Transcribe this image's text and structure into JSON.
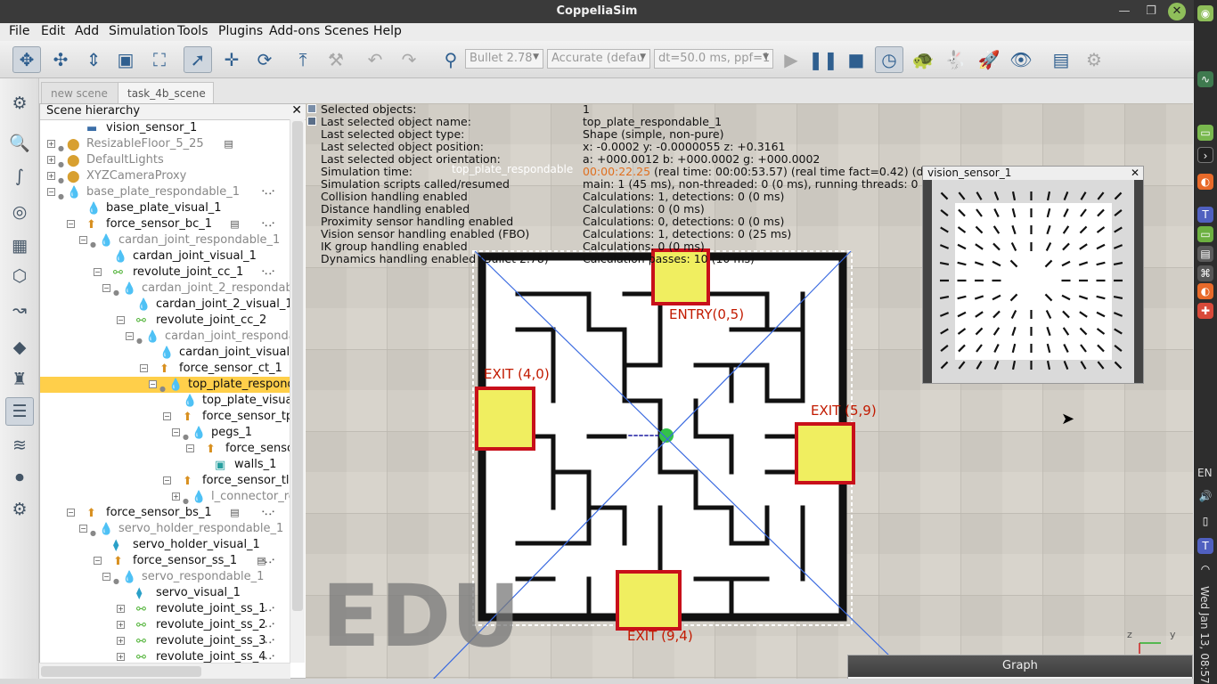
{
  "app": {
    "title": "CoppeliaSim"
  },
  "menu": [
    "File",
    "Edit",
    "Add",
    "Simulation",
    "Tools",
    "Plugins",
    "Add-ons",
    "Scenes",
    "Help"
  ],
  "toolbar": {
    "engine": "Bullet 2.78",
    "accuracy": "Accurate (defau",
    "dt": "dt=50.0 ms, ppf=1"
  },
  "tabs": [
    "new scene",
    "task_4b_scene"
  ],
  "hierarchy": {
    "title": "Scene hierarchy",
    "rows": [
      {
        "label": "vision_sensor_1",
        "indent": 50,
        "icon": "vision",
        "grey": false,
        "toggle": "",
        "eye": false
      },
      {
        "label": "ResizableFloor_5_25",
        "indent": 28,
        "icon": "model",
        "grey": true,
        "toggle": "+",
        "eye": true,
        "ext": "script"
      },
      {
        "label": "DefaultLights",
        "indent": 28,
        "icon": "model",
        "grey": true,
        "toggle": "+",
        "eye": true
      },
      {
        "label": "XYZCameraProxy",
        "indent": 28,
        "icon": "model",
        "grey": true,
        "toggle": "+",
        "eye": true
      },
      {
        "label": "base_plate_respondable_1",
        "indent": 28,
        "icon": "shape",
        "grey": true,
        "toggle": "-",
        "eye": true,
        "ext": "dots"
      },
      {
        "label": "base_plate_visual_1",
        "indent": 50,
        "icon": "shape",
        "grey": false,
        "toggle": "",
        "eye": false
      },
      {
        "label": "force_sensor_bc_1",
        "indent": 50,
        "icon": "force",
        "grey": false,
        "toggle": "-",
        "eye": false,
        "ext": "script-dots"
      },
      {
        "label": "cardan_joint_respondable_1",
        "indent": 64,
        "icon": "shape",
        "grey": true,
        "toggle": "-",
        "eye": true
      },
      {
        "label": "cardan_joint_visual_1",
        "indent": 80,
        "icon": "shape",
        "grey": false,
        "toggle": "",
        "eye": false
      },
      {
        "label": "revolute_joint_cc_1",
        "indent": 80,
        "icon": "joint",
        "grey": false,
        "toggle": "-",
        "eye": false,
        "ext": "dots"
      },
      {
        "label": "cardan_joint_2_respondable",
        "indent": 90,
        "icon": "shape",
        "grey": true,
        "toggle": "-",
        "eye": true
      },
      {
        "label": "cardan_joint_2_visual_1",
        "indent": 106,
        "icon": "shape",
        "grey": false,
        "toggle": "",
        "eye": false
      },
      {
        "label": "revolute_joint_cc_2",
        "indent": 106,
        "icon": "joint",
        "grey": false,
        "toggle": "-",
        "eye": false
      },
      {
        "label": "cardan_joint_responda",
        "indent": 116,
        "icon": "shape",
        "grey": true,
        "toggle": "-",
        "eye": true
      },
      {
        "label": "cardan_joint_visual_2",
        "indent": 132,
        "icon": "shape",
        "grey": false,
        "toggle": "",
        "eye": false
      },
      {
        "label": "force_sensor_ct_1",
        "indent": 132,
        "icon": "force",
        "grey": false,
        "toggle": "-",
        "eye": false,
        "ext": "script"
      },
      {
        "label": "top_plate_respond",
        "indent": 142,
        "icon": "shape",
        "grey": false,
        "toggle": "-",
        "eye": true,
        "selected": true
      },
      {
        "label": "top_plate_visual",
        "indent": 158,
        "icon": "shape",
        "grey": false,
        "toggle": "",
        "eye": false
      },
      {
        "label": "force_sensor_tp",
        "indent": 158,
        "icon": "force",
        "grey": false,
        "toggle": "-",
        "eye": false
      },
      {
        "label": "pegs_1",
        "indent": 168,
        "icon": "shape",
        "grey": false,
        "toggle": "-",
        "eye": true
      },
      {
        "label": "force_senso",
        "indent": 184,
        "icon": "force",
        "grey": false,
        "toggle": "-",
        "eye": false
      },
      {
        "label": "walls_1",
        "indent": 194,
        "icon": "box",
        "grey": false,
        "toggle": "",
        "eye": false
      },
      {
        "label": "force_sensor_tl",
        "indent": 158,
        "icon": "force",
        "grey": false,
        "toggle": "-",
        "eye": false
      },
      {
        "label": "l_connector_re",
        "indent": 168,
        "icon": "shape",
        "grey": true,
        "toggle": "+",
        "eye": true
      },
      {
        "label": "force_sensor_bs_1",
        "indent": 50,
        "icon": "force",
        "grey": false,
        "toggle": "-",
        "eye": false,
        "ext": "script-dots"
      },
      {
        "label": "servo_holder_respondable_1",
        "indent": 64,
        "icon": "shape",
        "grey": true,
        "toggle": "-",
        "eye": true
      },
      {
        "label": "servo_holder_visual_1",
        "indent": 80,
        "icon": "shape2",
        "grey": false,
        "toggle": "",
        "eye": false
      },
      {
        "label": "force_sensor_ss_1",
        "indent": 80,
        "icon": "force",
        "grey": false,
        "toggle": "-",
        "eye": false,
        "ext": "script-dots"
      },
      {
        "label": "servo_respondable_1",
        "indent": 90,
        "icon": "shape",
        "grey": true,
        "toggle": "-",
        "eye": true
      },
      {
        "label": "servo_visual_1",
        "indent": 106,
        "icon": "shape2",
        "grey": false,
        "toggle": "",
        "eye": false
      },
      {
        "label": "revolute_joint_ss_1",
        "indent": 106,
        "icon": "joint",
        "grey": false,
        "toggle": "+",
        "eye": false,
        "ext": "dots"
      },
      {
        "label": "revolute_joint_ss_2",
        "indent": 106,
        "icon": "joint",
        "grey": false,
        "toggle": "+",
        "eye": false,
        "ext": "dots"
      },
      {
        "label": "revolute_joint_ss_3",
        "indent": 106,
        "icon": "joint",
        "grey": false,
        "toggle": "+",
        "eye": false,
        "ext": "dots"
      },
      {
        "label": "revolute_joint_ss_4",
        "indent": 106,
        "icon": "joint",
        "grey": false,
        "toggle": "+",
        "eye": false,
        "ext": "dots"
      }
    ]
  },
  "info": [
    {
      "k": "Selected objects:",
      "v": "1"
    },
    {
      "k": "Last selected object name:",
      "v": "top_plate_respondable_1"
    },
    {
      "k": "Last selected object type:",
      "v": "Shape (simple, non-pure)"
    },
    {
      "k": "Last selected object position:",
      "v": "x: -0.0002    y: -0.0000055    z: +0.3161"
    },
    {
      "k": "Last selected object orientation:",
      "v": "a: +000.0012    b: +000.0002    g: +000.0002"
    },
    {
      "k": "Simulation time:",
      "v": "(real time: 00:00:53.57) (real time fact=0.42) (dt=50.0 ms)",
      "hl": "00:00:22.25"
    },
    {
      "k": "Simulation scripts called/resumed",
      "v": "main: 1 (45 ms), non-threaded: 0 (0 ms), running threads: 0 (1 ms)"
    },
    {
      "k": "Collision handling enabled",
      "v": "Calculations: 1, detections: 0 (0 ms)"
    },
    {
      "k": "Distance handling enabled",
      "v": "Calculations: 0 (0 ms)"
    },
    {
      "k": "Proximity sensor handling enabled",
      "v": "Calculations: 0, detections: 0 (0 ms)"
    },
    {
      "k": "Vision sensor handling enabled (FBO)",
      "v": "Calculations: 1, detections: 0 (25 ms)"
    },
    {
      "k": "IK group handling enabled",
      "v": "Calculations: 0 (0 ms)"
    },
    {
      "k": "Dynamics handling enabled (Bullet 2.78)",
      "v": "Calculation passes: 10 (10 ms)"
    }
  ],
  "scene": {
    "overlay_label": "top_plate_respondable",
    "watermark": "EDU",
    "labels": {
      "entry": "ENTRY(0,5)",
      "exit_left": "EXIT (4,0)",
      "exit_right": "EXIT (5,9)",
      "exit_bottom": "EXIT (9,4)"
    },
    "axes": {
      "y": "y",
      "z": "z"
    }
  },
  "vision_window": {
    "title": "vision_sensor_1"
  },
  "graph_window": {
    "title": "Graph"
  },
  "dock": {
    "lang": "EN",
    "datetime": "Wed Jan 13, 08:57"
  },
  "colors": {
    "accent": "#ffcf4a",
    "marker_fill": "#f0ee60",
    "marker_border": "#c8101a",
    "label_red": "#c21a00",
    "sim_time": "#e07020"
  }
}
